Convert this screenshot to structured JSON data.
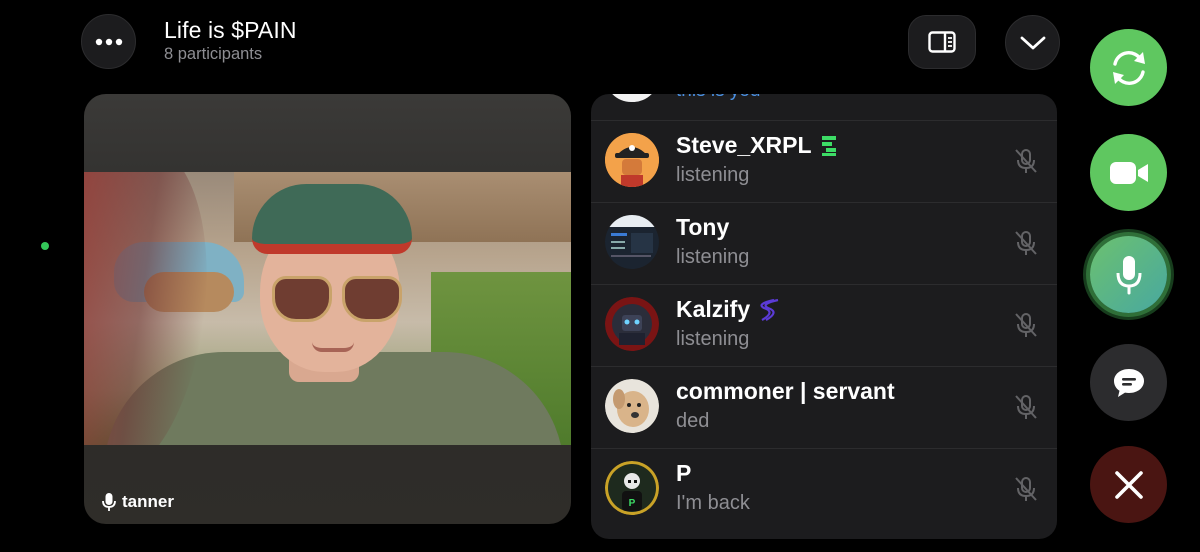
{
  "header": {
    "title": "Life is $PAIN",
    "subtitle": "8 participants"
  },
  "video": {
    "speaker_name": "tanner"
  },
  "participants_panel": {
    "self_label": "this is you",
    "participants": [
      {
        "name": "Steve_XRPL",
        "status": "listening",
        "badge_icon": "green-emoji-badge-icon"
      },
      {
        "name": "Tony",
        "status": "listening",
        "badge_icon": ""
      },
      {
        "name": "Kalzify",
        "status": "listening",
        "badge_icon": "purple-dna-badge-icon"
      },
      {
        "name": "commoner | servant",
        "status": "ded",
        "badge_icon": ""
      },
      {
        "name": "P",
        "status": "I'm back",
        "badge_icon": ""
      }
    ]
  },
  "controls": {
    "flip_icon": "camera-flip-icon",
    "video_icon": "video-camera-icon",
    "mic_icon": "microphone-icon",
    "chat_icon": "chat-bubble-icon",
    "leave_icon": "close-icon"
  },
  "colors": {
    "accent_green": "#5fc760",
    "link_blue": "#4a90e2",
    "leave_red": "#4a1512",
    "panel_bg": "#1c1c1e",
    "online_dot": "#34c759"
  }
}
